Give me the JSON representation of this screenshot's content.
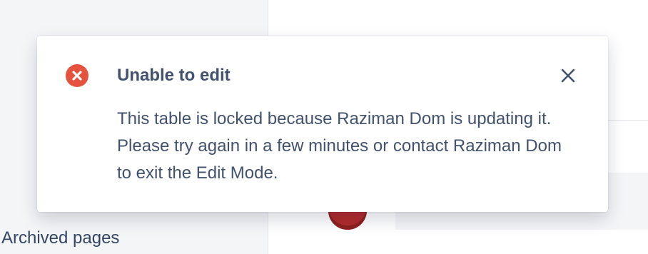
{
  "background": {
    "sidebar_link": "Archived pages"
  },
  "flag": {
    "status_icon": "error-icon",
    "title": "Unable to edit",
    "message": "This table is locked because Raziman Dom is updating it. Please try again in a few minutes or contact Raziman Dom to exit the Edit Mode.",
    "close_icon": "close-icon"
  },
  "colors": {
    "error": "#e5533f",
    "text": "#42526e"
  }
}
